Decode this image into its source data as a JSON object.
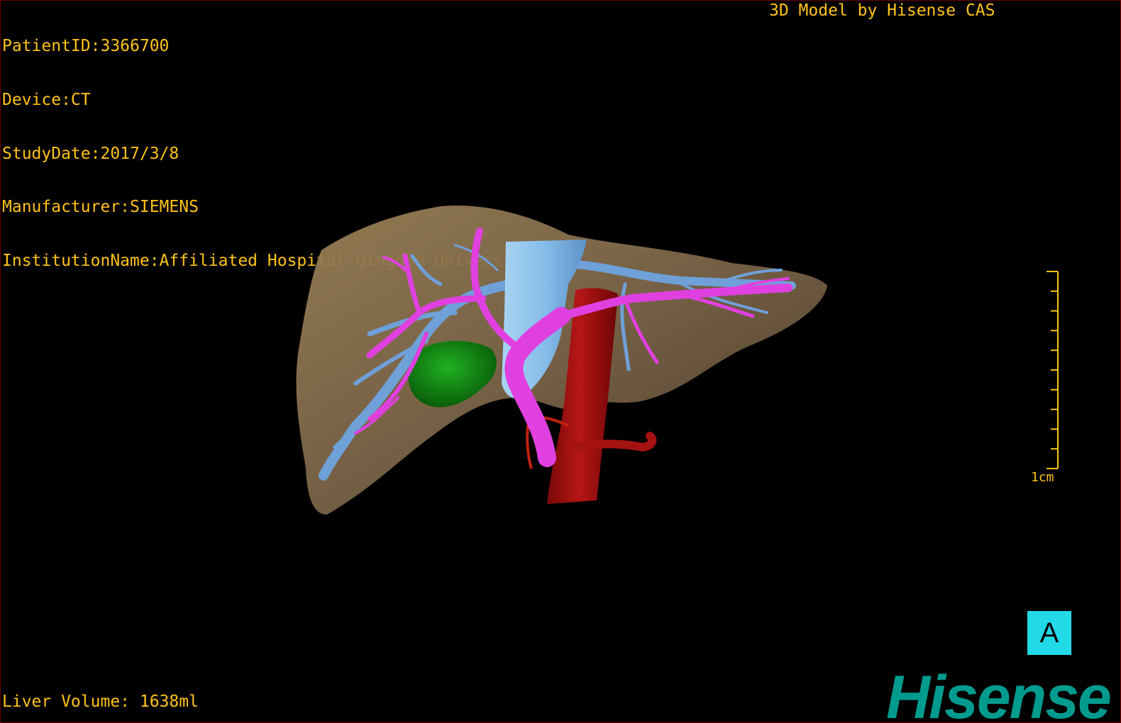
{
  "overlay": {
    "patient_id": "PatientID:3366700",
    "device": "Device:CT",
    "study_date": "StudyDate:2017/3/8",
    "manufacturer": "Manufacturer:SIEMENS",
    "institution": "InstitutionName:Affiliated Hospital Qingdao University-C",
    "credit": "3D Model by Hisense CAS",
    "liver_volume": "Liver Volume: 1638ml"
  },
  "scale_bar": {
    "label": "1cm",
    "tick_count": 11
  },
  "view_badge": {
    "label": "A",
    "color": "#22d9e8"
  },
  "brand": {
    "logo_text": "Hisense",
    "color": "#009b8f"
  },
  "colors": {
    "text": "#ffc21a",
    "liver": "#7a6448",
    "portal_vein": "#e040e0",
    "hepatic_vein": "#6fa0d8",
    "ivc": "#8cc6ee",
    "aorta": "#a81010",
    "lesion": "#128c12",
    "border": "#6b0000"
  }
}
